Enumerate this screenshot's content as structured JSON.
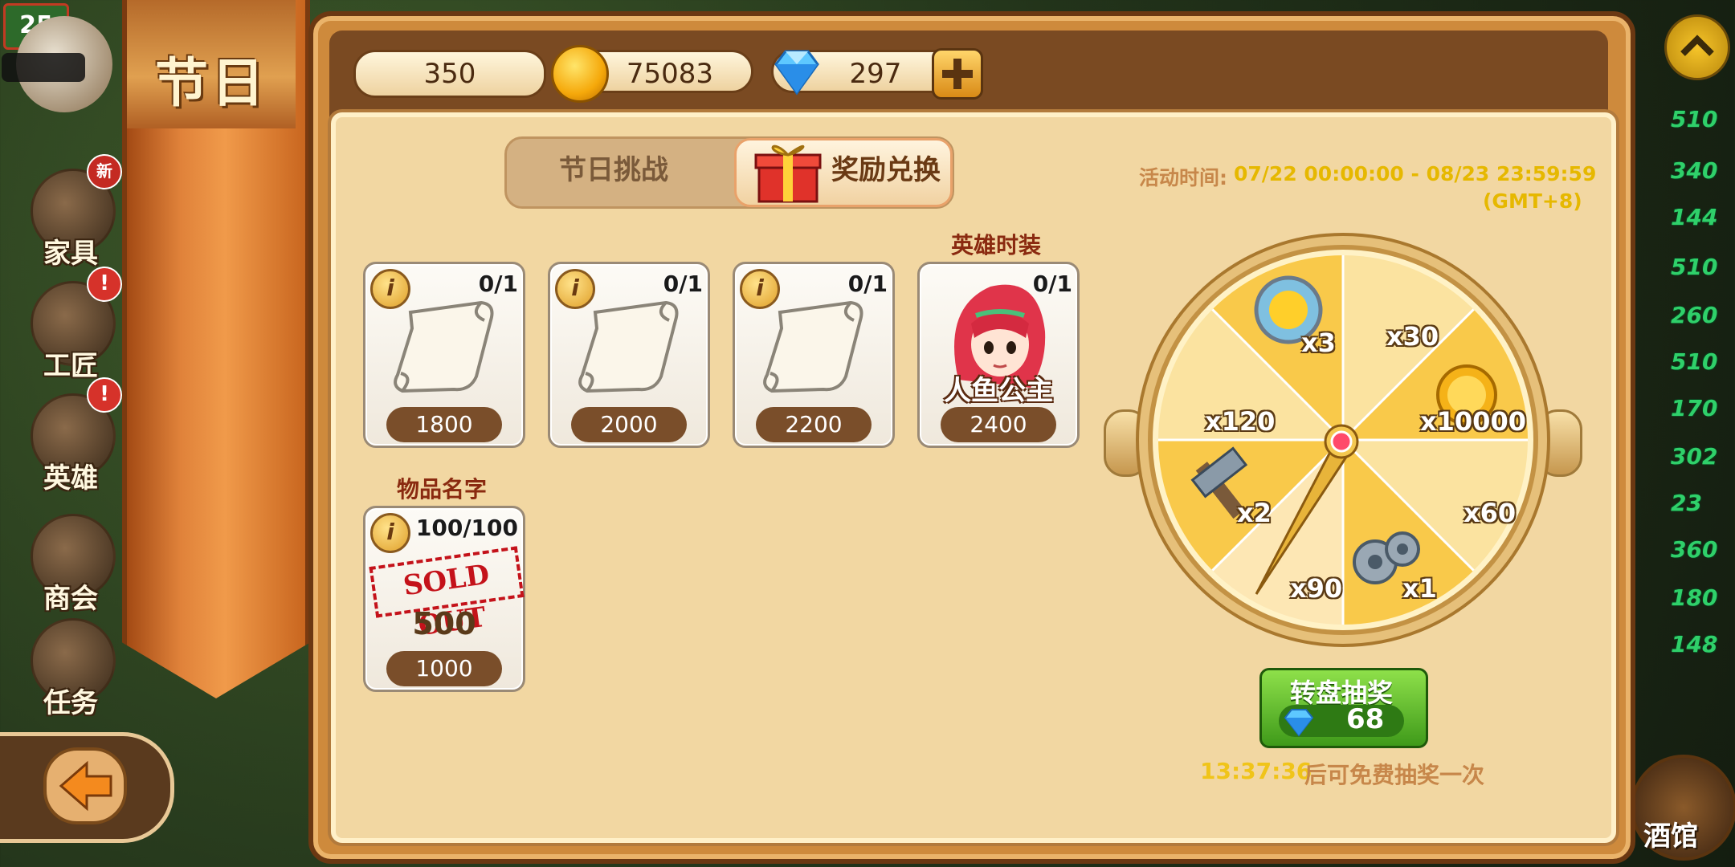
{
  "player": {
    "level": "25"
  },
  "side_menu": [
    {
      "label": "家具",
      "badge": "新"
    },
    {
      "label": "工匠",
      "badge": "!"
    },
    {
      "label": "英雄",
      "badge": "!"
    },
    {
      "label": "商会",
      "badge": ""
    },
    {
      "label": "任务",
      "badge": ""
    }
  ],
  "banner": {
    "title": "节日"
  },
  "currencies": {
    "stamina": "350",
    "gold": "75083",
    "gems": "297"
  },
  "tabs": {
    "challenge": "节日挑战",
    "exchange": "奖励兑换",
    "selected": "exchange"
  },
  "event_time": {
    "label": "活动时间:",
    "range": "07/22 00:00:00 - 08/23 23:59:59",
    "timezone": "(GMT+8)"
  },
  "items": [
    {
      "icon": "scroll-icon",
      "count": "0/1",
      "price": "1800",
      "title": ""
    },
    {
      "icon": "scroll-icon",
      "count": "0/1",
      "price": "2000",
      "title": ""
    },
    {
      "icon": "scroll-icon",
      "count": "0/1",
      "price": "2200",
      "title": ""
    },
    {
      "icon": "hero-portrait-icon",
      "count": "0/1",
      "price": "2400",
      "title": "英雄时装",
      "overlay": "人鱼公主"
    },
    {
      "icon": "sold-out-stamp",
      "count": "100/100",
      "price": "1000",
      "title": "物品名字",
      "stamp": "SOLD OUT",
      "amount": "500"
    }
  ],
  "wheel": {
    "labels": [
      "x3",
      "x30",
      "x10000",
      "x60",
      "x1",
      "x90",
      "x2",
      "x120"
    ]
  },
  "spin": {
    "label": "转盘抽奖",
    "cost": "68"
  },
  "free": {
    "timer": "13:37:36",
    "text": "后可免费抽奖一次"
  },
  "right_list": [
    "510",
    "340",
    "144",
    "510",
    "260",
    "510",
    "170",
    "302",
    "23",
    "360",
    "180",
    "148"
  ],
  "tavern": {
    "label": "酒馆"
  },
  "colors": {
    "gold_text": "#e6b800",
    "tan_text": "#c7874a",
    "green_button": "#3f9a1a",
    "sold_out_red": "#c4121a"
  }
}
